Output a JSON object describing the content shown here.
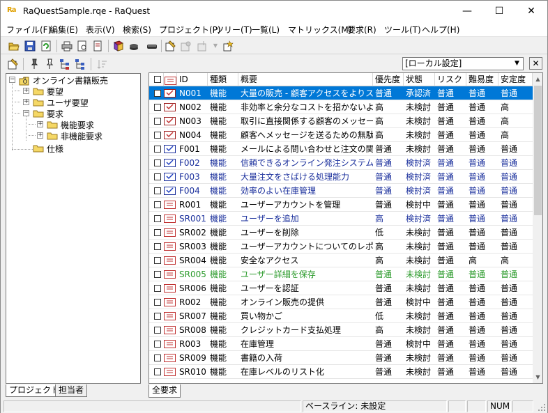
{
  "window": {
    "title": "RaQuestSample.rqe - RaQuest",
    "app_icon_text": "Ra",
    "minimize_glyph": "—",
    "maximize_glyph": "☐",
    "close_glyph": "✕"
  },
  "menu": [
    "ファイル(F)",
    "編集(E)",
    "表示(V)",
    "検索(S)",
    "プロジェクト(P)",
    "ツリー(T)",
    "一覧(L)",
    "マトリックス(M)",
    "要求(R)",
    "ツール(T)",
    "ヘルプ(H)"
  ],
  "toolbar_icons": [
    "open-folder-icon",
    "save-icon",
    "refresh-icon",
    "print-icon",
    "print-preview-icon",
    "page-setup-icon",
    "book-icon",
    "disk-icon",
    "properties-icon",
    "settings-icon",
    "add-dropdown-icon",
    "wizard-icon"
  ],
  "tree": {
    "root": "オンライン書籍販売",
    "nodes": [
      {
        "label": "要望"
      },
      {
        "label": "ユーザ要望"
      },
      {
        "label": "要求"
      },
      {
        "label": "機能要求"
      },
      {
        "label": "非機能要求"
      },
      {
        "label": "仕様"
      }
    ]
  },
  "left_tabs": [
    "プロジェクト",
    "担当者"
  ],
  "filter": {
    "selected": "[ローカル設定]",
    "close_label": "✕"
  },
  "grid": {
    "columns": [
      "ID",
      "種類",
      "概要",
      "優先度",
      "状態",
      "リスク",
      "難易度",
      "安定度"
    ],
    "rows": [
      {
        "id": "N001",
        "type": "機能",
        "summary": "大量の販売 - 顧客アクセスをよりスム",
        "priority": "普通",
        "status": "承認済",
        "risk": "普通",
        "difficulty": "普通",
        "stability": "普通",
        "color": "#ffffff",
        "icon": "need",
        "selected": true
      },
      {
        "id": "N002",
        "type": "機能",
        "summary": "非効率と余分なコストを招かないよう",
        "priority": "高",
        "status": "未検討",
        "risk": "普通",
        "difficulty": "普通",
        "stability": "高",
        "color": "#000000",
        "icon": "need",
        "selected": false
      },
      {
        "id": "N003",
        "type": "機能",
        "summary": "取引に直接関係する顧客のメッセージ",
        "priority": "高",
        "status": "未検討",
        "risk": "普通",
        "difficulty": "普通",
        "stability": "高",
        "color": "#000000",
        "icon": "need",
        "selected": false
      },
      {
        "id": "N004",
        "type": "機能",
        "summary": "顧客へメッセージを送るための無駄な",
        "priority": "高",
        "status": "未検討",
        "risk": "普通",
        "difficulty": "普通",
        "stability": "高",
        "color": "#000000",
        "icon": "need",
        "selected": false
      },
      {
        "id": "F001",
        "type": "機能",
        "summary": "メールによる問い合わせと注文の関連",
        "priority": "普通",
        "status": "未検討",
        "risk": "普通",
        "difficulty": "普通",
        "stability": "普通",
        "color": "#000000",
        "icon": "feature",
        "selected": false
      },
      {
        "id": "F002",
        "type": "機能",
        "summary": "信頼できるオンライン発注システム",
        "priority": "普通",
        "status": "検討済",
        "risk": "普通",
        "difficulty": "普通",
        "stability": "普通",
        "color": "#1a2f9c",
        "icon": "feature",
        "selected": false
      },
      {
        "id": "F003",
        "type": "機能",
        "summary": "大量注文をさばける処理能力",
        "priority": "普通",
        "status": "検討済",
        "risk": "普通",
        "difficulty": "普通",
        "stability": "普通",
        "color": "#1a2f9c",
        "icon": "feature",
        "selected": false
      },
      {
        "id": "F004",
        "type": "機能",
        "summary": "効率のよい在庫管理",
        "priority": "普通",
        "status": "検討済",
        "risk": "普通",
        "difficulty": "普通",
        "stability": "普通",
        "color": "#1a2f9c",
        "icon": "feature",
        "selected": false
      },
      {
        "id": "R001",
        "type": "機能",
        "summary": "ユーザーアカウントを管理",
        "priority": "普通",
        "status": "検討中",
        "risk": "普通",
        "difficulty": "普通",
        "stability": "普通",
        "color": "#000000",
        "icon": "req",
        "selected": false
      },
      {
        "id": "SR001",
        "type": "機能",
        "summary": "ユーザーを追加",
        "priority": "高",
        "status": "検討済",
        "risk": "普通",
        "difficulty": "普通",
        "stability": "普通",
        "color": "#1a2f9c",
        "icon": "req",
        "selected": false
      },
      {
        "id": "SR002",
        "type": "機能",
        "summary": "ユーザーを削除",
        "priority": "低",
        "status": "未検討",
        "risk": "普通",
        "difficulty": "普通",
        "stability": "普通",
        "color": "#000000",
        "icon": "req",
        "selected": false
      },
      {
        "id": "SR003",
        "type": "機能",
        "summary": "ユーザーアカウントについてのレポー",
        "priority": "高",
        "status": "未検討",
        "risk": "普通",
        "difficulty": "普通",
        "stability": "普通",
        "color": "#000000",
        "icon": "req",
        "selected": false
      },
      {
        "id": "SR004",
        "type": "機能",
        "summary": "安全なアクセス",
        "priority": "高",
        "status": "未検討",
        "risk": "普通",
        "difficulty": "高",
        "stability": "高",
        "color": "#000000",
        "icon": "req",
        "selected": false
      },
      {
        "id": "SR005",
        "type": "機能",
        "summary": "ユーザー詳細を保存",
        "priority": "普通",
        "status": "未検討",
        "risk": "普通",
        "difficulty": "普通",
        "stability": "普通",
        "color": "#2a9a2a",
        "icon": "req",
        "selected": false
      },
      {
        "id": "SR006",
        "type": "機能",
        "summary": "ユーザーを認証",
        "priority": "普通",
        "status": "未検討",
        "risk": "普通",
        "difficulty": "普通",
        "stability": "普通",
        "color": "#000000",
        "icon": "req",
        "selected": false
      },
      {
        "id": "R002",
        "type": "機能",
        "summary": "オンライン販売の提供",
        "priority": "普通",
        "status": "検討中",
        "risk": "普通",
        "difficulty": "普通",
        "stability": "普通",
        "color": "#000000",
        "icon": "req",
        "selected": false
      },
      {
        "id": "SR007",
        "type": "機能",
        "summary": "買い物かご",
        "priority": "低",
        "status": "未検討",
        "risk": "普通",
        "difficulty": "普通",
        "stability": "普通",
        "color": "#000000",
        "icon": "req",
        "selected": false
      },
      {
        "id": "SR008",
        "type": "機能",
        "summary": "クレジットカード支払処理",
        "priority": "高",
        "status": "未検討",
        "risk": "普通",
        "difficulty": "普通",
        "stability": "普通",
        "color": "#000000",
        "icon": "req",
        "selected": false
      },
      {
        "id": "R003",
        "type": "機能",
        "summary": "在庫管理",
        "priority": "普通",
        "status": "検討中",
        "risk": "普通",
        "difficulty": "普通",
        "stability": "普通",
        "color": "#000000",
        "icon": "req",
        "selected": false
      },
      {
        "id": "SR009",
        "type": "機能",
        "summary": "書籍の入荷",
        "priority": "普通",
        "status": "未検討",
        "risk": "普通",
        "difficulty": "普通",
        "stability": "普通",
        "color": "#000000",
        "icon": "req",
        "selected": false
      },
      {
        "id": "SR010",
        "type": "機能",
        "summary": "在庫レベルのリスト化",
        "priority": "普通",
        "status": "未検討",
        "risk": "普通",
        "difficulty": "普通",
        "stability": "普通",
        "color": "#000000",
        "icon": "req",
        "selected": false
      }
    ]
  },
  "right_tab": "全要求",
  "status": {
    "baseline": "ベースライン: 未設定",
    "num": "NUM"
  }
}
